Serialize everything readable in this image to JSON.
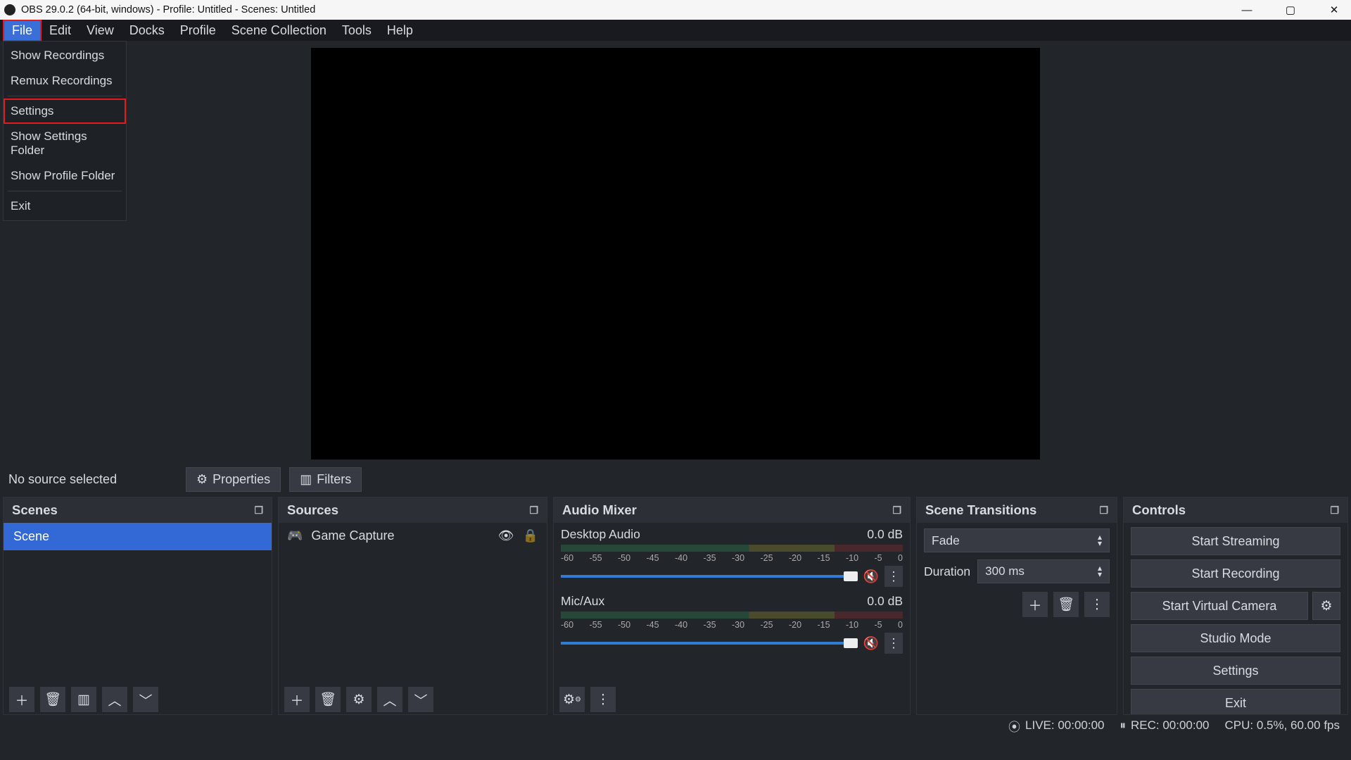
{
  "titlebar": {
    "title": "OBS 29.0.2 (64-bit, windows) - Profile: Untitled - Scenes: Untitled"
  },
  "menubar": [
    "File",
    "Edit",
    "View",
    "Docks",
    "Profile",
    "Scene Collection",
    "Tools",
    "Help"
  ],
  "dropdown": {
    "items": [
      "Show Recordings",
      "Remux Recordings",
      "Settings",
      "Show Settings Folder",
      "Show Profile Folder",
      "Exit"
    ]
  },
  "info": {
    "no_source": "No source selected",
    "properties": "Properties",
    "filters": "Filters"
  },
  "panels": {
    "scenes": {
      "title": "Scenes",
      "item": "Scene"
    },
    "sources": {
      "title": "Sources",
      "item": "Game Capture"
    },
    "mixer": {
      "title": "Audio Mixer",
      "tracks": [
        {
          "name": "Desktop Audio",
          "db": "0.0 dB"
        },
        {
          "name": "Mic/Aux",
          "db": "0.0 dB"
        }
      ],
      "ticks": [
        "-60",
        "-55",
        "-50",
        "-45",
        "-40",
        "-35",
        "-30",
        "-25",
        "-20",
        "-15",
        "-10",
        "-5",
        "0"
      ]
    },
    "transitions": {
      "title": "Scene Transitions",
      "value": "Fade",
      "duration_label": "Duration",
      "duration_value": "300 ms"
    },
    "controls": {
      "title": "Controls",
      "buttons": {
        "stream": "Start Streaming",
        "record": "Start Recording",
        "vcam": "Start Virtual Camera",
        "studio": "Studio Mode",
        "settings": "Settings",
        "exit": "Exit"
      }
    }
  },
  "status": {
    "live": "LIVE: 00:00:00",
    "rec": "REC: 00:00:00",
    "cpu": "CPU: 0.5%, 60.00 fps"
  }
}
